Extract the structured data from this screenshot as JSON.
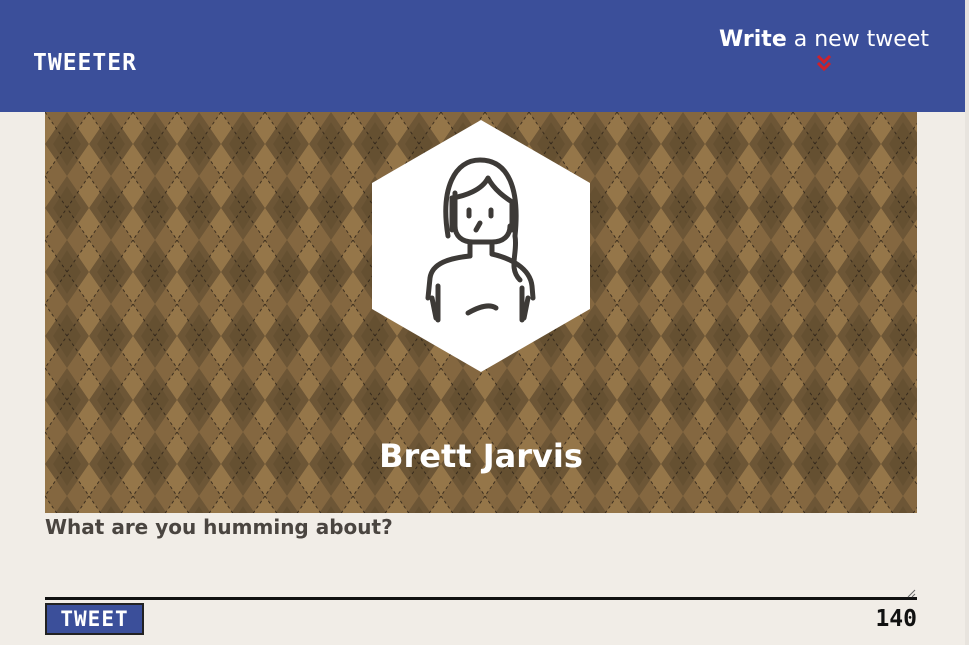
{
  "nav": {
    "brand": "TWEETER",
    "compose_bold": "Write",
    "compose_rest": " a new tweet"
  },
  "profile": {
    "name": "Brett Jarvis",
    "avatar_icon": "woman-avatar-icon"
  },
  "compose": {
    "prompt": "What are you humming about?",
    "textarea_value": "",
    "button_label": "TWEET",
    "char_count": "140"
  },
  "colors": {
    "nav_bg": "#3b4f9a",
    "page_bg": "#f1ede7",
    "argyle_light": "#8d6e45",
    "argyle_dark": "#6b5536",
    "chevron": "#d0202a"
  }
}
